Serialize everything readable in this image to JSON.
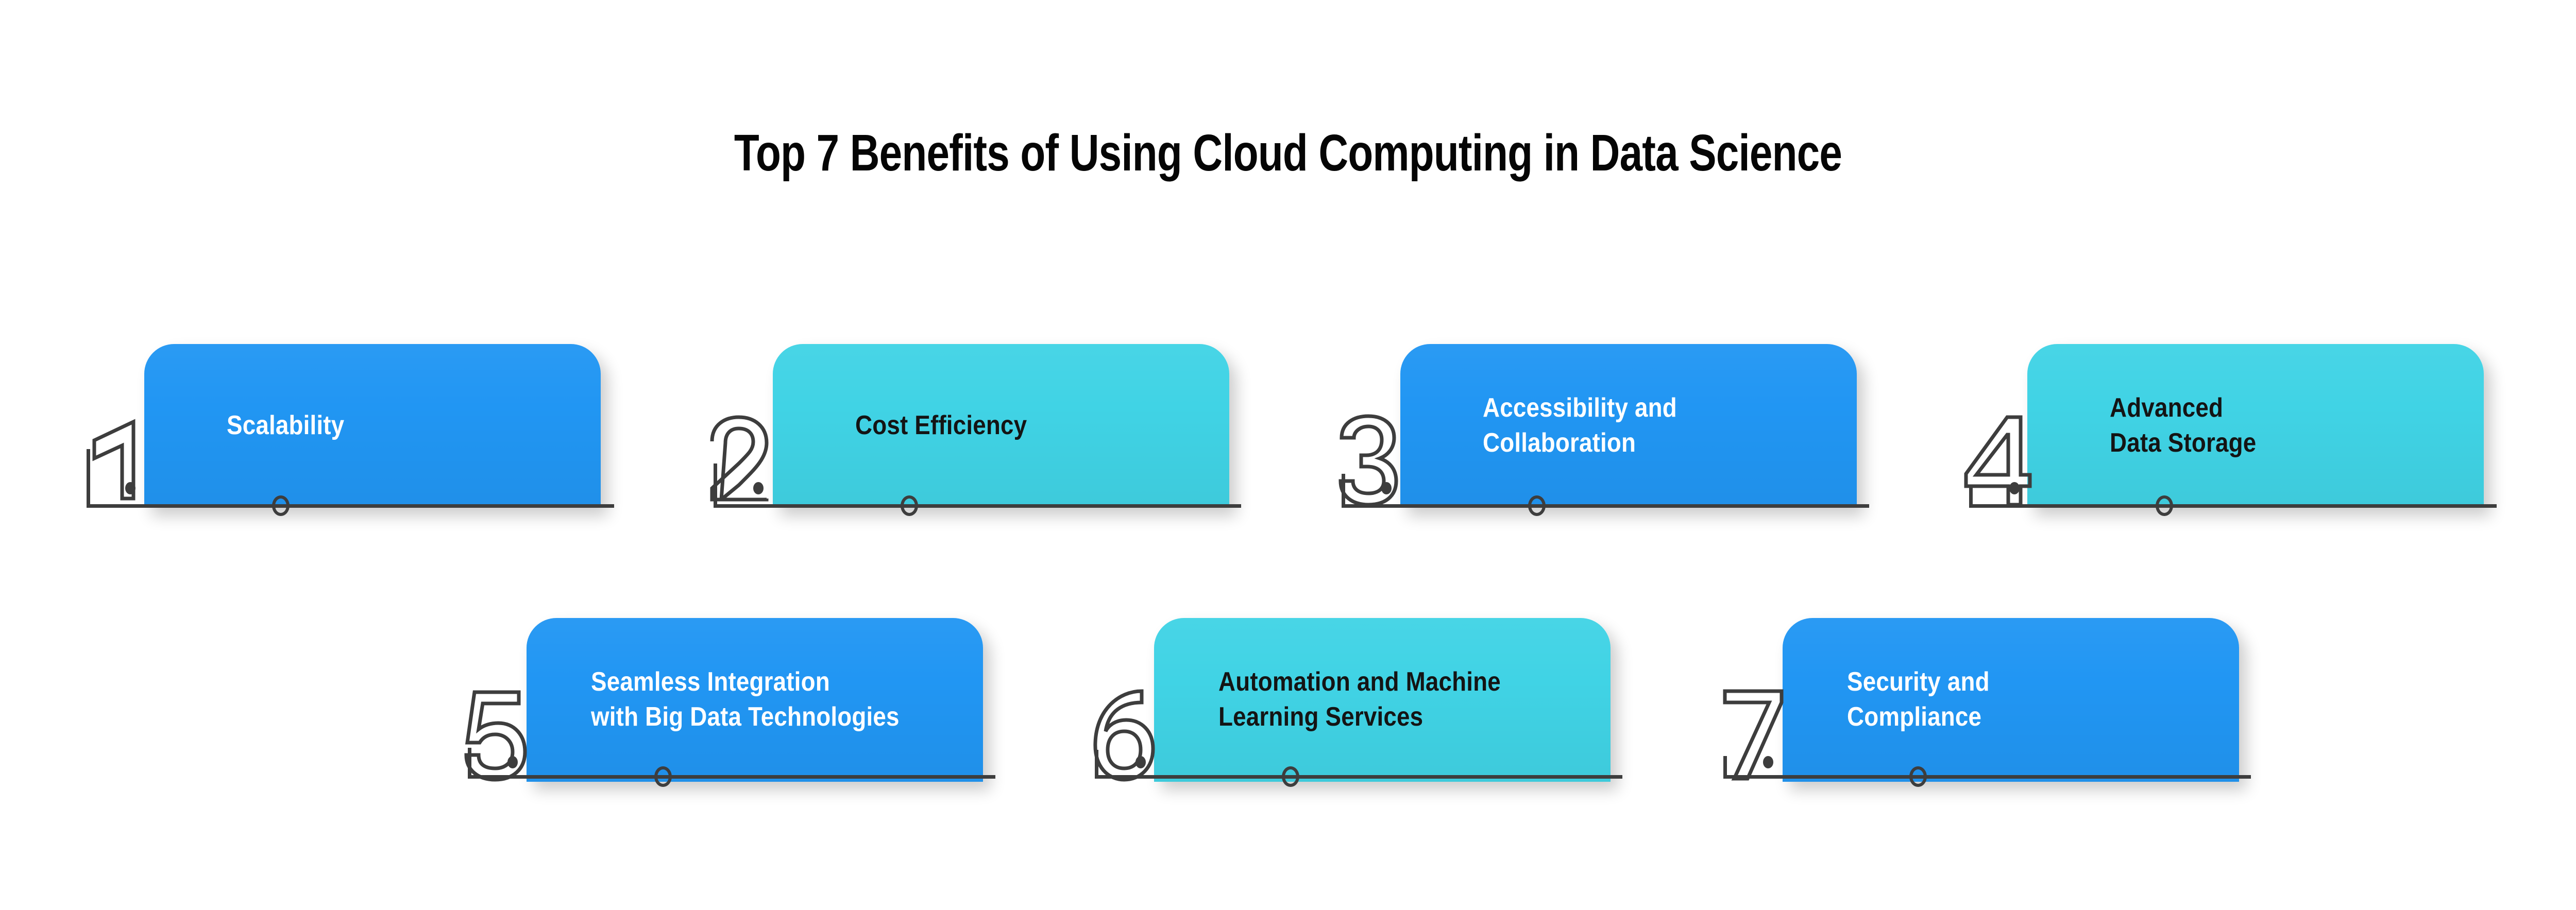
{
  "title": "Top 7 Benefits of Using Cloud Computing in Data Science",
  "colors": {
    "background": "#ffffff",
    "blue": "#2196f3",
    "teal": "#40d3e5",
    "text_on_blue": "#ffffff",
    "text_on_teal": "#141414",
    "title_text": "#050505",
    "numeral_stroke": "#3d3d3d"
  },
  "cards": [
    {
      "number": "1",
      "label": "Scalability",
      "theme": "blue"
    },
    {
      "number": "2",
      "label": "Cost Efficiency",
      "theme": "teal"
    },
    {
      "number": "3",
      "label": "Accessibility and\nCollaboration",
      "theme": "blue"
    },
    {
      "number": "4",
      "label": "Advanced\nData Storage",
      "theme": "teal"
    },
    {
      "number": "5",
      "label": "Seamless Integration\nwith Big Data Technologies",
      "theme": "blue"
    },
    {
      "number": "6",
      "label": "Automation and Machine\nLearning Services",
      "theme": "teal"
    },
    {
      "number": "7",
      "label": "Security and\nCompliance",
      "theme": "blue"
    }
  ]
}
